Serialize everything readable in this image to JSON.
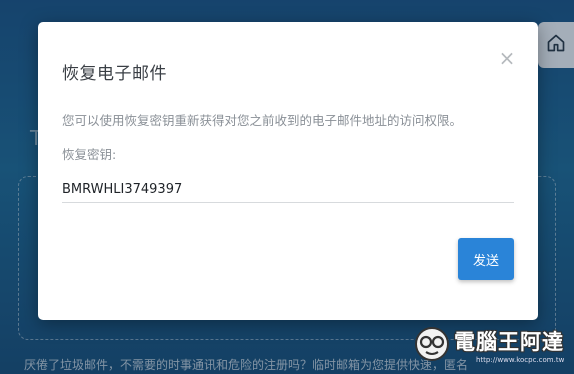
{
  "background": {
    "letter_left": "T",
    "letter_right": "s",
    "bottom_text": "厌倦了垃圾邮件，不需要的时事通讯和危险的注册吗？临时邮箱为您提供快速，匿名"
  },
  "modal": {
    "title": "恢复电子邮件",
    "close_symbol": "×",
    "description": "您可以使用恢复密钥重新获得对您之前收到的电子邮件地址的访问权限。",
    "recovery_label": "恢复密钥:",
    "recovery_value": "BMRWHLI3749397",
    "send_label": "发送"
  },
  "watermark": {
    "logo_text": "電腦王阿達",
    "url": "http://www.kocpc.com.tw"
  },
  "colors": {
    "accent": "#2a84d8",
    "background": "#1d5a87"
  }
}
